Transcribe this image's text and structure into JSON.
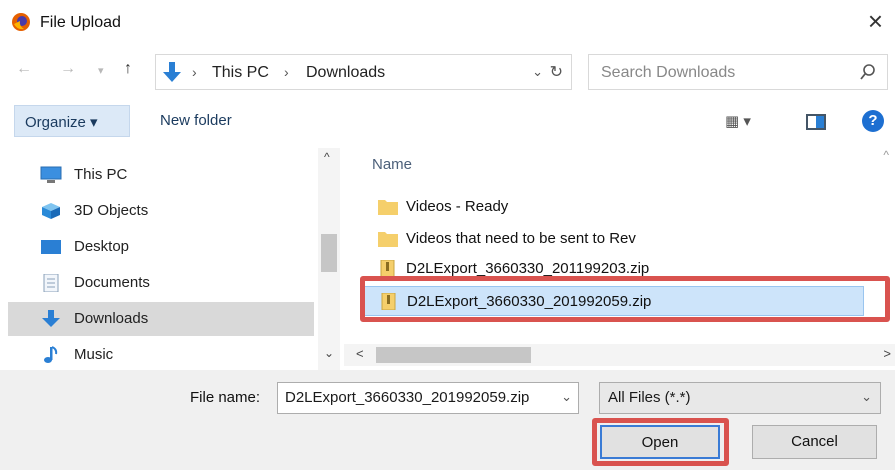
{
  "window": {
    "title": "File Upload",
    "close_glyph": "×"
  },
  "address": {
    "segments": [
      "This PC",
      "Downloads"
    ],
    "search_placeholder": "Search Downloads"
  },
  "toolbar": {
    "organize_label": "Organize ▾",
    "new_folder_label": "New folder",
    "view_label": "▦ ▾",
    "help_label": "?"
  },
  "nav_pane": {
    "items": [
      {
        "label": "This PC",
        "icon": "monitor-icon"
      },
      {
        "label": "3D Objects",
        "icon": "cube-icon"
      },
      {
        "label": "Desktop",
        "icon": "desktop-icon"
      },
      {
        "label": "Documents",
        "icon": "document-icon"
      },
      {
        "label": "Downloads",
        "icon": "download-arrow-icon",
        "selected": true
      },
      {
        "label": "Music",
        "icon": "music-note-icon"
      }
    ]
  },
  "file_list": {
    "column_name": "Name",
    "rows": [
      {
        "name": "Videos - Ready",
        "icon": "folder-icon"
      },
      {
        "name": "Videos that need to be sent to Rev",
        "icon": "folder-icon"
      },
      {
        "name": "D2LExport_3660330_201199203.zip",
        "icon": "zip-file-icon"
      },
      {
        "name": "D2LExport_3660330_201992059.zip",
        "icon": "zip-file-icon",
        "selected": true
      }
    ]
  },
  "bottom": {
    "file_name_label": "File name:",
    "file_name_value": "D2LExport_3660330_201992059.zip",
    "filter_value": "All Files (*.*)",
    "open_label": "Open",
    "cancel_label": "Cancel"
  },
  "colors": {
    "highlight": "#d9534f",
    "selection": "#cde4fa",
    "accent": "#1d6fd1",
    "folder": "#f5cf6b"
  }
}
